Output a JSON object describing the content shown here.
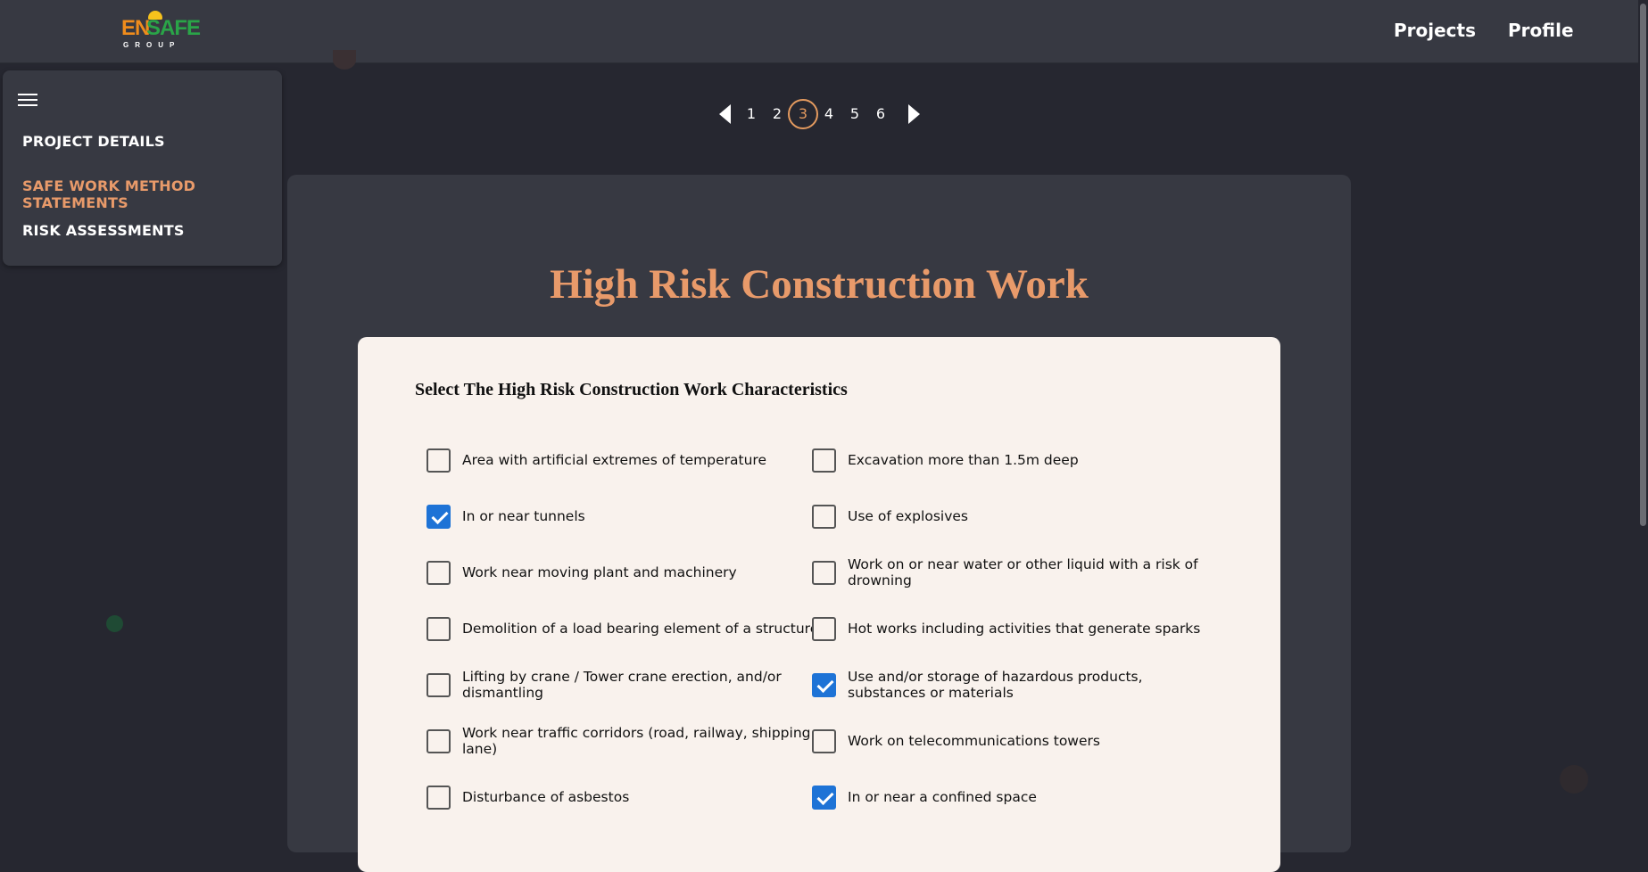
{
  "header": {
    "logo": {
      "en": "EN",
      "safe": "SAFE",
      "group": "GROUP"
    },
    "nav": {
      "projects": "Projects",
      "profile": "Profile"
    }
  },
  "sidebar": {
    "items": [
      {
        "label": "PROJECT DETAILS",
        "active": false
      },
      {
        "label": "SAFE WORK METHOD STATEMENTS",
        "active": true
      },
      {
        "label": "RISK ASSESSMENTS",
        "active": false
      }
    ]
  },
  "pagination": {
    "pages": [
      "1",
      "2",
      "3",
      "4",
      "5",
      "6"
    ],
    "current": "3"
  },
  "main": {
    "title": "High Risk Construction Work",
    "form_heading": "Select The High Risk Construction Work Characteristics",
    "options": [
      {
        "label": "Area with artificial extremes of temperature",
        "checked": false
      },
      {
        "label": "Excavation more than 1.5m deep",
        "checked": false
      },
      {
        "label": "In or near tunnels",
        "checked": true
      },
      {
        "label": "Use of explosives",
        "checked": false
      },
      {
        "label": "Work near moving plant and machinery",
        "checked": false
      },
      {
        "label": "Work on or near water or other liquid with a risk of drowning",
        "checked": false
      },
      {
        "label": "Demolition of a load bearing element of a structure",
        "checked": false
      },
      {
        "label": "Hot works including activities that generate sparks",
        "checked": false
      },
      {
        "label": "Lifting by crane / Tower crane erection, and/or dismantling",
        "checked": false
      },
      {
        "label": "Use and/or storage of hazardous products, substances or materials",
        "checked": true
      },
      {
        "label": "Work near traffic corridors (road, railway, shipping lane)",
        "checked": false
      },
      {
        "label": "Work on telecommunications towers",
        "checked": false
      },
      {
        "label": "Disturbance of asbestos",
        "checked": false
      },
      {
        "label": "In or near a confined space",
        "checked": true
      }
    ]
  },
  "colors": {
    "accent": "#e89a6a",
    "checkbox_checked": "#1e73d6",
    "background": "#262730",
    "card": "#373942",
    "panel": "#f9f2ed"
  }
}
